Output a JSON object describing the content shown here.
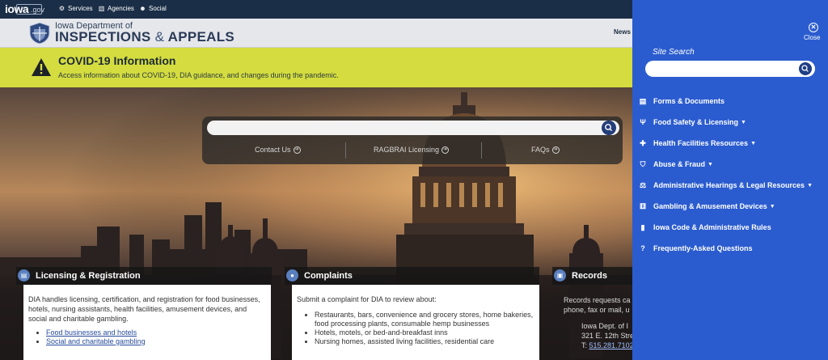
{
  "topbar": {
    "logo_text": "iowa",
    "logo_suffix": ".gov",
    "links": [
      {
        "label": "Services",
        "icon": "gears-icon"
      },
      {
        "label": "Agencies",
        "icon": "building-icon"
      },
      {
        "label": "Social",
        "icon": "people-icon"
      }
    ]
  },
  "header": {
    "agency_top": "Iowa Department of",
    "agency_main_a": "INSPECTIONS",
    "agency_amp": "&",
    "agency_main_b": "APPEALS",
    "nav_partial": "News"
  },
  "covid": {
    "title": "COVID-19 Information",
    "text": "Access information about COVID-19, DIA guidance, and changes during the pandemic."
  },
  "hero": {
    "search_value": "",
    "quick_links": [
      "Contact Us",
      "RAGBRAI Licensing",
      "FAQs"
    ]
  },
  "cards": {
    "licensing": {
      "title": "Licensing & Registration",
      "intro": "DIA handles licensing, certification, and registration for food businesses, hotels, nursing assistants, health facilities, amusement devices, and social and charitable gambling.",
      "links": [
        "Food businesses and hotels",
        "Social and charitable gambling"
      ]
    },
    "complaints": {
      "title": "Complaints",
      "intro": "Submit a complaint for DIA to review about:",
      "items": [
        "Restaurants, bars, convenience and grocery stores, home bakeries, food processing plants, consumable hemp businesses",
        "Hotels, motels, or bed-and-breakfast inns",
        "Nursing homes, assisted living facilities, residential care"
      ]
    },
    "records": {
      "title": "Records",
      "line1": "Records requests ca",
      "line2": "phone, fax or mail, u",
      "addr1": "Iowa Dept. of I",
      "addr2": "321 E. 12th Stre",
      "phone_prefix": "T:",
      "phone": "515.281.7102"
    }
  },
  "side_menu": {
    "close_label": "Close",
    "search_label": "Site Search",
    "search_value": "",
    "items": [
      {
        "label": "Forms & Documents",
        "icon": "document-icon",
        "dropdown": false
      },
      {
        "label": "Food Safety & Licensing",
        "icon": "utensils-icon",
        "dropdown": true
      },
      {
        "label": "Health Facilities Resources",
        "icon": "clinic-icon",
        "dropdown": true
      },
      {
        "label": "Abuse & Fraud",
        "icon": "shield-icon",
        "dropdown": true
      },
      {
        "label": "Administrative Hearings & Legal Resources",
        "icon": "scales-icon",
        "dropdown": true
      },
      {
        "label": "Gambling & Amusement Devices",
        "icon": "dice-icon",
        "dropdown": true
      },
      {
        "label": "Iowa Code & Administrative Rules",
        "icon": "book-icon",
        "dropdown": false
      },
      {
        "label": "Frequently-Asked Questions",
        "icon": "question-icon",
        "dropdown": false
      }
    ]
  },
  "colors": {
    "topbar": "#1b2e47",
    "covid_banner": "#d4dc3f",
    "side_menu": "#2b5ccf",
    "link": "#274b9c"
  }
}
